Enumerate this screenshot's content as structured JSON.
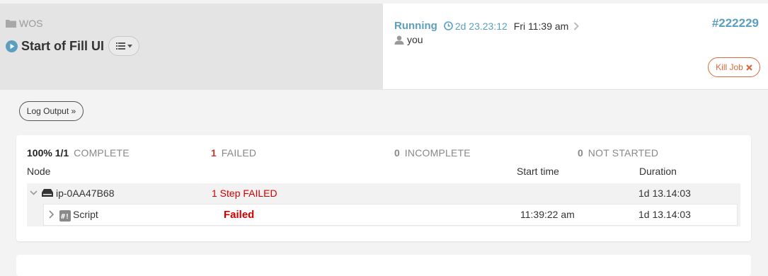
{
  "header": {
    "project_name": "WOS",
    "job_title": "Start of Fill UI",
    "status": "Running",
    "elapsed": "2d 23.23:12",
    "started_at": "Fri 11:39 am",
    "user": "you",
    "job_id": "#222229",
    "kill_label": "Kill Job"
  },
  "actions": {
    "log_output_label": "Log Output »"
  },
  "summary": {
    "complete": {
      "pct": "100% 1/1",
      "label": "COMPLETE"
    },
    "failed": {
      "count": "1",
      "label": "FAILED"
    },
    "incomplete": {
      "count": "0",
      "label": "INCOMPLETE"
    },
    "not_started": {
      "count": "0",
      "label": "NOT STARTED"
    }
  },
  "table": {
    "headers": {
      "node": "Node",
      "start_time": "Start time",
      "duration": "Duration"
    },
    "node": {
      "name": "ip-0AA47B68",
      "status": "1 Step FAILED",
      "duration": "1d 13.14:03"
    },
    "step": {
      "name": "Script",
      "status": "Failed",
      "start_time": "11:39:22 am",
      "duration": "1d 13.14:03"
    }
  },
  "colors": {
    "accent": "#5a9fbf",
    "danger": "#d96a3a",
    "failed": "#d00000"
  },
  "icons": [
    "folder-icon",
    "play-circle-icon",
    "list-menu-icon",
    "clock-icon",
    "chevron-right-icon",
    "user-icon",
    "close-icon",
    "chevron-down-icon",
    "server-icon",
    "script-icon"
  ]
}
